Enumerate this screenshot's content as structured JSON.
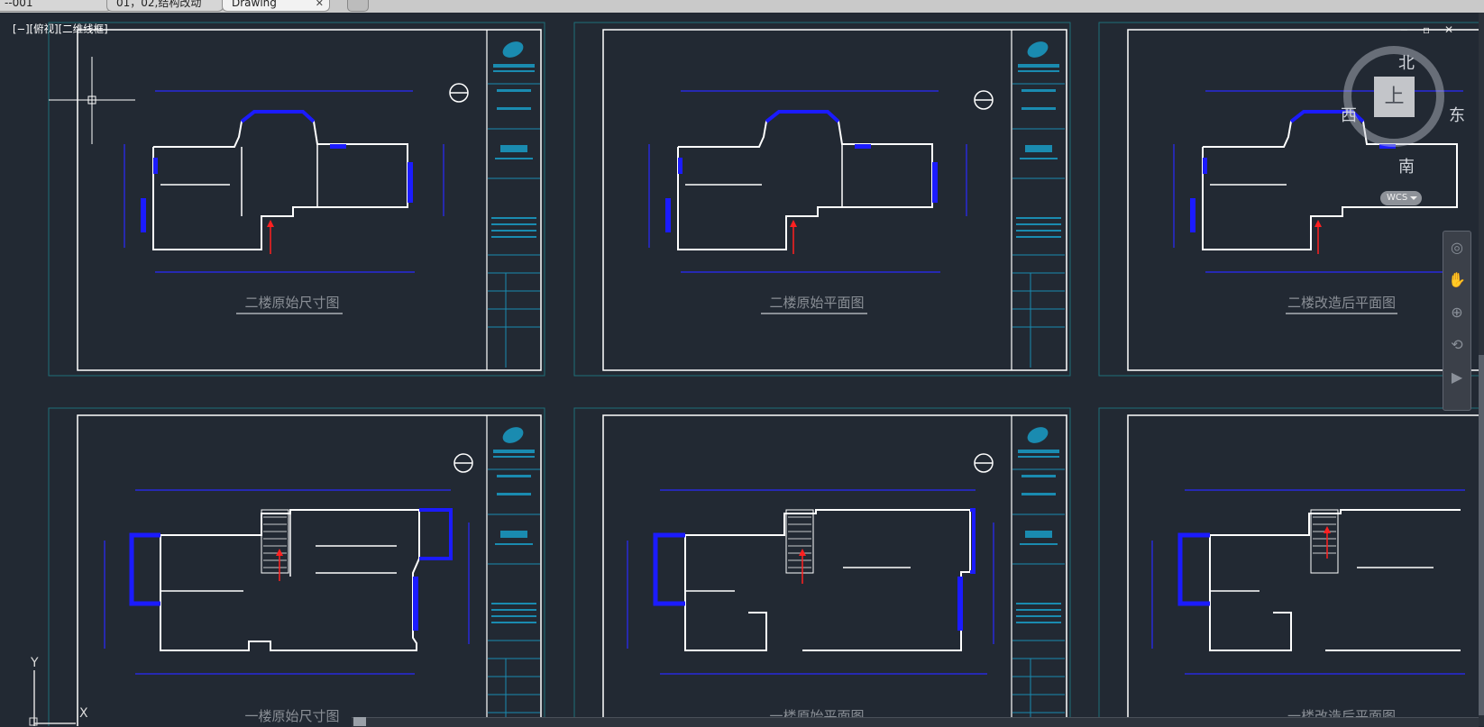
{
  "tabs": [
    {
      "label": "--001"
    },
    {
      "label": "01，02,结构改动"
    },
    {
      "label": "Drawing",
      "active": true,
      "close": "✕"
    }
  ],
  "viewport": {
    "label": "[−][俯视][二维线框]",
    "window_controls": "− ▫ ✕"
  },
  "viewcube": {
    "face": "上",
    "north": "北",
    "south": "南",
    "west": "西",
    "east": "东",
    "wcs_label": "WCS"
  },
  "navbar": {
    "icons": [
      "steering-wheel-icon",
      "pan-icon",
      "zoom-icon",
      "orbit-icon",
      "showmotion-icon"
    ]
  },
  "ucs": {
    "y": "Y",
    "x": "X"
  },
  "sheets": [
    {
      "title": "二楼原始尺寸图"
    },
    {
      "title": "二楼原始平面图"
    },
    {
      "title": "二楼改造后平面图"
    },
    {
      "title": "一楼原始尺寸图"
    },
    {
      "title": "一楼原始平面图"
    },
    {
      "title": "一楼改造后平面图"
    }
  ],
  "colors": {
    "background": "#222933",
    "sheet_border": "#ffffff",
    "viewport_frame": "#1f6e78",
    "wall": "#ffffff",
    "window": "#1b1bff",
    "dimension": "#2a2aff",
    "arrow": "#ff2020",
    "title_text": "#8a8f96",
    "titleblock_accent": "#1a8bb0"
  }
}
